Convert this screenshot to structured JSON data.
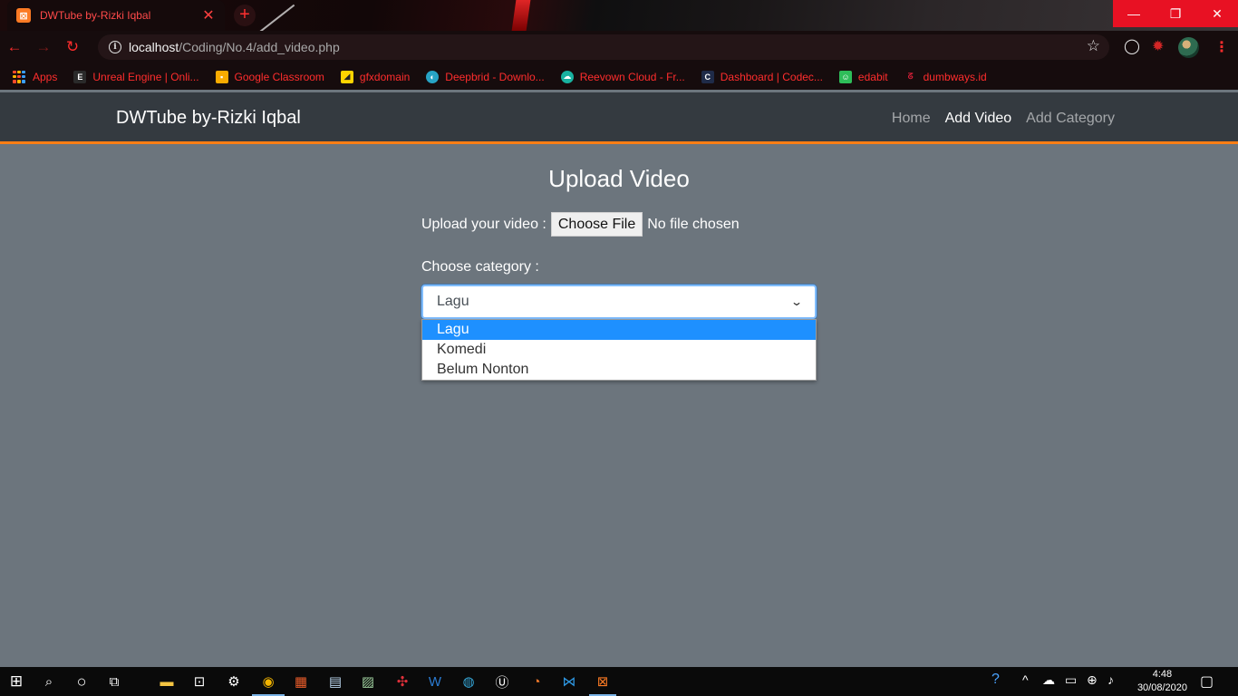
{
  "browser": {
    "tab_title": "DWTube by-Rizki Iqbal",
    "tab_icon": "xampp-icon",
    "new_tab": "+",
    "window_controls": [
      "minimize",
      "restore",
      "close"
    ],
    "url_host": "localhost",
    "url_path": "/Coding/No.4/add_video.php",
    "bookmarks": [
      {
        "label": "Apps",
        "icon": "apps-grid-icon"
      },
      {
        "label": "Unreal Engine | Onli...",
        "icon": "epic-icon",
        "color": "#2a2a2a"
      },
      {
        "label": "Google Classroom",
        "icon": "classroom-icon",
        "color": "#f9ab00"
      },
      {
        "label": "gfxdomain",
        "icon": "gfx-icon",
        "color": "#ffd400"
      },
      {
        "label": "Deepbrid - Downlo...",
        "icon": "deepbrid-icon",
        "color": "#27a3c4"
      },
      {
        "label": "Reevown Cloud - Fr...",
        "icon": "cloud-icon",
        "color": "#18b2a0"
      },
      {
        "label": "Dashboard | Codec...",
        "icon": "codecademy-icon",
        "color": "#1f2b48"
      },
      {
        "label": "edabit",
        "icon": "edabit-icon",
        "color": "#2ebd59"
      },
      {
        "label": "dumbways.id",
        "icon": "dumbways-icon",
        "color": "#e0203a"
      }
    ]
  },
  "site": {
    "brand": "DWTube by-Rizki Iqbal",
    "nav": [
      "Home",
      "Add Video",
      "Add Category"
    ],
    "active_nav": "Add Video",
    "accent_color": "#fd7e14"
  },
  "form": {
    "heading": "Upload Video",
    "upload_label": "Upload your video :",
    "choose_file_label": "Choose File",
    "no_file_text": "No file chosen",
    "category_label": "Choose category :",
    "selected_category": "Lagu",
    "category_options": [
      "Lagu",
      "Komedi",
      "Belum Nonton"
    ]
  },
  "taskbar": {
    "time": "4:48",
    "date": "30/08/2020"
  }
}
